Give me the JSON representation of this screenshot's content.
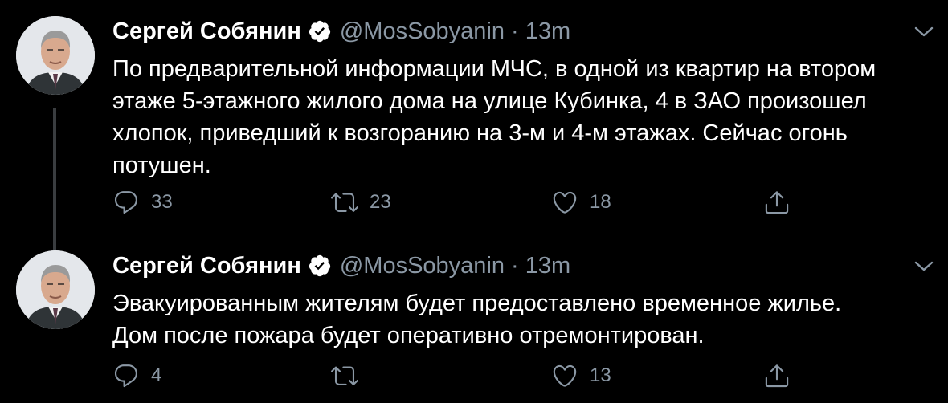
{
  "colors": {
    "background": "#000000",
    "primary_text": "#ffffff",
    "secondary_text": "#8b98a5",
    "thread_line": "#3a3d40"
  },
  "icons": {
    "verified": "verified-badge-icon",
    "caret": "chevron-down-icon",
    "reply": "reply-icon",
    "retweet": "retweet-icon",
    "like": "heart-icon",
    "share": "share-icon"
  },
  "tweets": [
    {
      "author": "Сергей Собянин",
      "handle": "@MosSobyanin",
      "separator": "·",
      "time": "13m",
      "text": "По предварительной информации МЧС, в одной из квартир на втором\nэтаже 5-этажного жилого дома на улице Кубинка, 4 в ЗАО произошел\nхлопок, приведший к возгоранию на 3-м и 4-м этажах. Сейчас огонь\nпотушен.",
      "replies": "33",
      "retweets": "23",
      "likes": "18"
    },
    {
      "author": "Сергей Собянин",
      "handle": "@MosSobyanin",
      "separator": "·",
      "time": "13m",
      "text": "Эвакуированным жителям будет предоставлено временное жилье.\nДом после пожара будет оперативно отремонтирован.",
      "replies": "4",
      "retweets": "",
      "likes": "13"
    }
  ]
}
